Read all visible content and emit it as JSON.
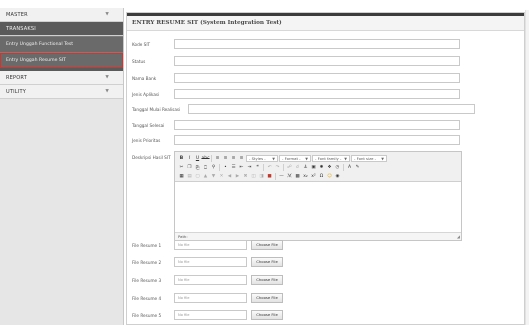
{
  "sidebar": {
    "sections": [
      {
        "label": "MASTER",
        "open": false
      },
      {
        "label": "TRANSAKSI",
        "open": true,
        "children": [
          {
            "label": "Entry Unggah Functional Test",
            "active": false
          },
          {
            "label": "Entry Unggah Resume SIT",
            "active": true
          }
        ]
      },
      {
        "label": "REPORT",
        "open": false
      },
      {
        "label": "UTILITY",
        "open": false
      }
    ],
    "chevron": "chevron-down-icon"
  },
  "panel": {
    "title": "ENTRY RESUME SIT (System Integration Test)"
  },
  "form": {
    "kode_sit": {
      "label": "Kode SIT",
      "value": ""
    },
    "status": {
      "label": "Status",
      "value": ""
    },
    "nama_bank": {
      "label": "Nama Bank",
      "value": ""
    },
    "jenis_aplikasi": {
      "label": "Jenis Aplikasi",
      "value": ""
    },
    "tanggal_mulai": {
      "label": "Tanggal Mulai Realisasi",
      "value": ""
    },
    "tanggal_selesai": {
      "label": "Tanggal Selesai",
      "value": ""
    },
    "jenis_prioritas": {
      "label": "Jenis Prioritas",
      "value": ""
    },
    "deskripsi": {
      "label": "Deskripsi Hasil SIT"
    }
  },
  "editor": {
    "selects": {
      "style": "- Styles -",
      "format": "- Format -",
      "font_family": "- Font family -",
      "font_size": "- Font size -"
    },
    "status_path": "Path:"
  },
  "files": [
    {
      "label": "File Resume 1",
      "placeholder": "No file",
      "button": "Choose File"
    },
    {
      "label": "File Resume 2",
      "placeholder": "No file",
      "button": "Choose File"
    },
    {
      "label": "File Resume 3",
      "placeholder": "No file",
      "button": "Choose File"
    },
    {
      "label": "File Resume 4",
      "placeholder": "No file",
      "button": "Choose File"
    },
    {
      "label": "File Resume 5",
      "placeholder": "No file",
      "button": "Choose File"
    }
  ],
  "colors": {
    "accent_outline": "#d8322d",
    "sidebar_dark": "#6a6a6a",
    "title_bar": "#3c3c3c"
  }
}
